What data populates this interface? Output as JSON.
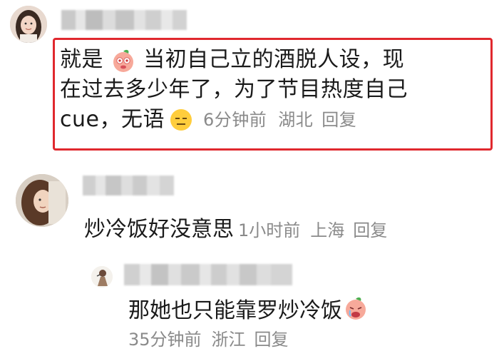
{
  "comments": [
    {
      "body_line1_a": "就是",
      "body_line1_b": "当初自己立的酒脱人设，现",
      "body_line2": "在过去多少年了，为了节目热度自己",
      "body_line3": "cue，无语",
      "time": "6分钟前",
      "location": "湖北",
      "reply_label": "回复",
      "emoji1": "peach-smile-emoji",
      "emoji2": "speechless-face-emoji"
    },
    {
      "body": "炒冷饭好没意思",
      "time": "1小时前",
      "location": "上海",
      "reply_label": "回复"
    },
    {
      "body": "那她也只能靠罗炒冷饭",
      "time": "35分钟前",
      "location": "浙江",
      "reply_label": "回复",
      "emoji": "peach-cry-emoji"
    }
  ],
  "colors": {
    "highlight_border": "#e0282e",
    "meta_text": "#8a8a8a",
    "body_text": "#1a1a1a"
  }
}
